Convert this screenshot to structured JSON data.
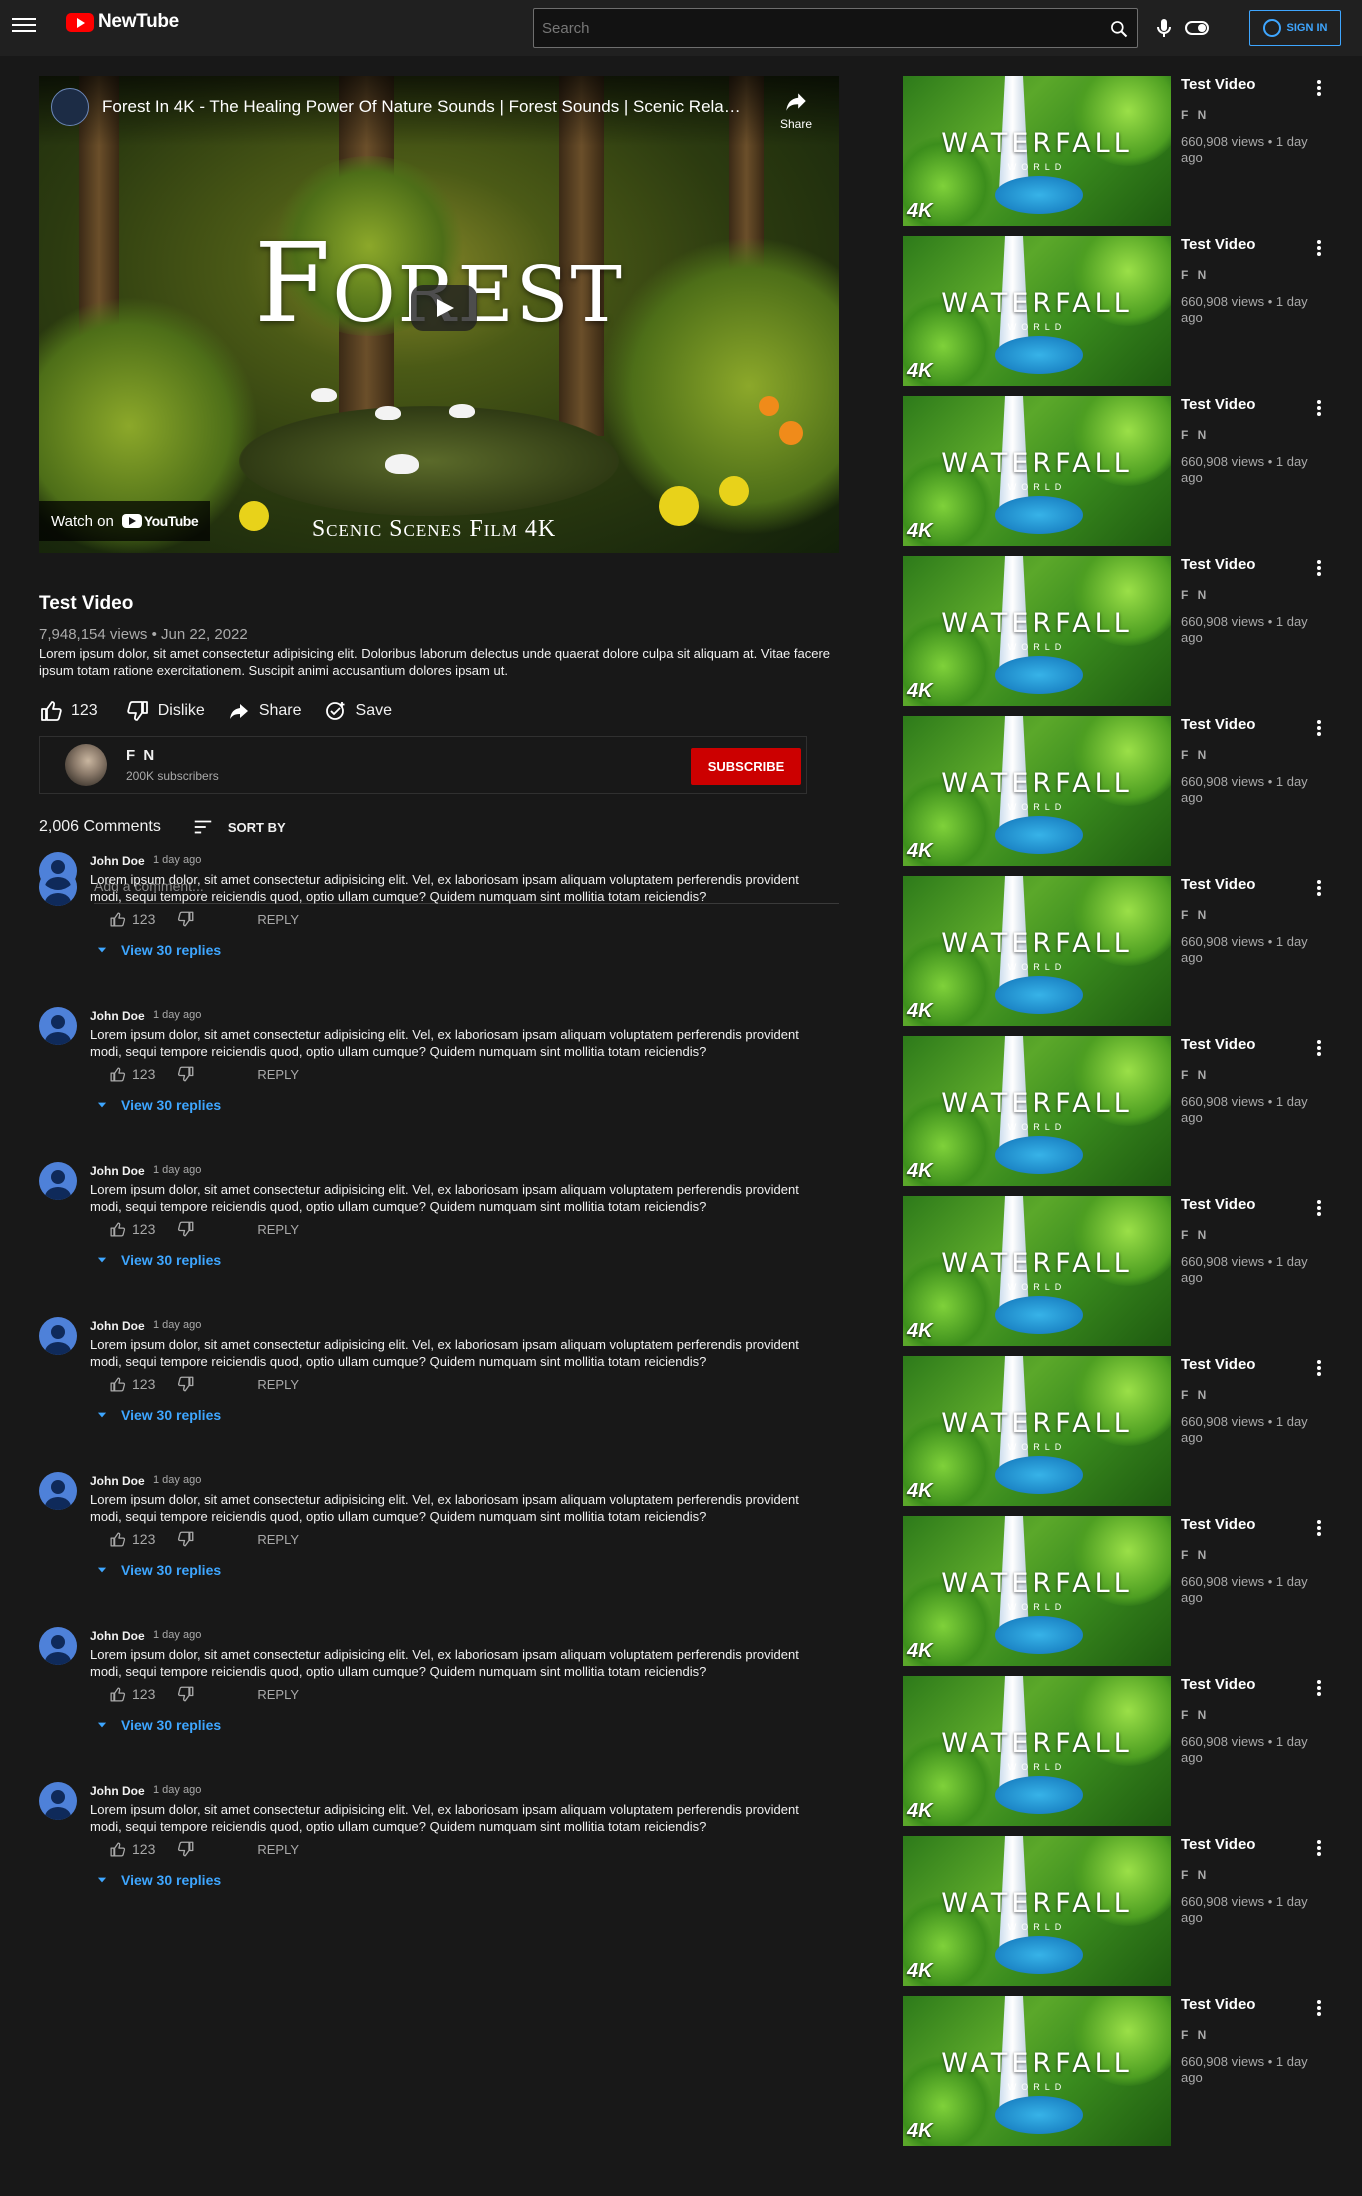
{
  "header": {
    "logo_text": "NewTube",
    "search_placeholder": "Search",
    "sign_in": "SIGN IN"
  },
  "player": {
    "overlay_title": "Forest In 4K - The Healing Power Of Nature Sounds | Forest Sounds | Scenic Rela…",
    "share": "Share",
    "big_word": "Forest",
    "scenic_text": "Scenic Scenes Film 4K",
    "watch_on": "Watch on",
    "youtube": "YouTube"
  },
  "video": {
    "title": "Test Video",
    "meta": "7,948,154 views • Jun 22, 2022",
    "description": "Lorem ipsum dolor, sit amet consectetur adipisicing elit. Doloribus laborum delectus unde quaerat dolore culpa sit aliquam at. Vitae facere ipsum totam ratione exercitationem. Suscipit animi accusantium dolores ipsam ut.",
    "likes": "123",
    "dislike": "Dislike",
    "share": "Share",
    "save": "Save"
  },
  "channel": {
    "name": "F N",
    "subscribers": "200K subscribers",
    "subscribe": "SUBSCRIBE"
  },
  "comments": {
    "count": "2,006 Comments",
    "sort_by": "SORT BY",
    "add_placeholder": "Add a comment...",
    "items": [
      {
        "author": "John Doe",
        "time": "1 day ago",
        "text": "Lorem ipsum dolor, sit amet consectetur adipisicing elit. Vel, ex laboriosam ipsam aliquam voluptatem perferendis provident modi, sequi tempore reiciendis quod, optio ullam cumque? Quidem numquam sint mollitia totam reiciendis?",
        "likes": "123",
        "reply": "REPLY",
        "replies": "View 30 replies"
      },
      {
        "author": "John Doe",
        "time": "1 day ago",
        "text": "Lorem ipsum dolor, sit amet consectetur adipisicing elit. Vel, ex laboriosam ipsam aliquam voluptatem perferendis provident modi, sequi tempore reiciendis quod, optio ullam cumque? Quidem numquam sint mollitia totam reiciendis?",
        "likes": "123",
        "reply": "REPLY",
        "replies": "View 30 replies"
      },
      {
        "author": "John Doe",
        "time": "1 day ago",
        "text": "Lorem ipsum dolor, sit amet consectetur adipisicing elit. Vel, ex laboriosam ipsam aliquam voluptatem perferendis provident modi, sequi tempore reiciendis quod, optio ullam cumque? Quidem numquam sint mollitia totam reiciendis?",
        "likes": "123",
        "reply": "REPLY",
        "replies": "View 30 replies"
      },
      {
        "author": "John Doe",
        "time": "1 day ago",
        "text": "Lorem ipsum dolor, sit amet consectetur adipisicing elit. Vel, ex laboriosam ipsam aliquam voluptatem perferendis provident modi, sequi tempore reiciendis quod, optio ullam cumque? Quidem numquam sint mollitia totam reiciendis?",
        "likes": "123",
        "reply": "REPLY",
        "replies": "View 30 replies"
      },
      {
        "author": "John Doe",
        "time": "1 day ago",
        "text": "Lorem ipsum dolor, sit amet consectetur adipisicing elit. Vel, ex laboriosam ipsam aliquam voluptatem perferendis provident modi, sequi tempore reiciendis quod, optio ullam cumque? Quidem numquam sint mollitia totam reiciendis?",
        "likes": "123",
        "reply": "REPLY",
        "replies": "View 30 replies"
      },
      {
        "author": "John Doe",
        "time": "1 day ago",
        "text": "Lorem ipsum dolor, sit amet consectetur adipisicing elit. Vel, ex laboriosam ipsam aliquam voluptatem perferendis provident modi, sequi tempore reiciendis quod, optio ullam cumque? Quidem numquam sint mollitia totam reiciendis?",
        "likes": "123",
        "reply": "REPLY",
        "replies": "View 30 replies"
      },
      {
        "author": "John Doe",
        "time": "1 day ago",
        "text": "Lorem ipsum dolor, sit amet consectetur adipisicing elit. Vel, ex laboriosam ipsam aliquam voluptatem perferendis provident modi, sequi tempore reiciendis quod, optio ullam cumque? Quidem numquam sint mollitia totam reiciendis?",
        "likes": "123",
        "reply": "REPLY",
        "replies": "View 30 replies"
      }
    ]
  },
  "sidebar": {
    "items": [
      {
        "title": "Test Video",
        "channel": "F N",
        "meta": "660,908 views • 1 day ago",
        "thumb_text": "WATERFALL",
        "thumb_sub": "WORLD",
        "thumb_badge": "4K"
      },
      {
        "title": "Test Video",
        "channel": "F N",
        "meta": "660,908 views • 1 day ago",
        "thumb_text": "WATERFALL",
        "thumb_sub": "WORLD",
        "thumb_badge": "4K"
      },
      {
        "title": "Test Video",
        "channel": "F N",
        "meta": "660,908 views • 1 day ago",
        "thumb_text": "WATERFALL",
        "thumb_sub": "WORLD",
        "thumb_badge": "4K"
      },
      {
        "title": "Test Video",
        "channel": "F N",
        "meta": "660,908 views • 1 day ago",
        "thumb_text": "WATERFALL",
        "thumb_sub": "WORLD",
        "thumb_badge": "4K"
      },
      {
        "title": "Test Video",
        "channel": "F N",
        "meta": "660,908 views • 1 day ago",
        "thumb_text": "WATERFALL",
        "thumb_sub": "WORLD",
        "thumb_badge": "4K"
      },
      {
        "title": "Test Video",
        "channel": "F N",
        "meta": "660,908 views • 1 day ago",
        "thumb_text": "WATERFALL",
        "thumb_sub": "WORLD",
        "thumb_badge": "4K"
      },
      {
        "title": "Test Video",
        "channel": "F N",
        "meta": "660,908 views • 1 day ago",
        "thumb_text": "WATERFALL",
        "thumb_sub": "WORLD",
        "thumb_badge": "4K"
      },
      {
        "title": "Test Video",
        "channel": "F N",
        "meta": "660,908 views • 1 day ago",
        "thumb_text": "WATERFALL",
        "thumb_sub": "WORLD",
        "thumb_badge": "4K"
      },
      {
        "title": "Test Video",
        "channel": "F N",
        "meta": "660,908 views • 1 day ago",
        "thumb_text": "WATERFALL",
        "thumb_sub": "WORLD",
        "thumb_badge": "4K"
      },
      {
        "title": "Test Video",
        "channel": "F N",
        "meta": "660,908 views • 1 day ago",
        "thumb_text": "WATERFALL",
        "thumb_sub": "WORLD",
        "thumb_badge": "4K"
      },
      {
        "title": "Test Video",
        "channel": "F N",
        "meta": "660,908 views • 1 day ago",
        "thumb_text": "WATERFALL",
        "thumb_sub": "WORLD",
        "thumb_badge": "4K"
      },
      {
        "title": "Test Video",
        "channel": "F N",
        "meta": "660,908 views • 1 day ago",
        "thumb_text": "WATERFALL",
        "thumb_sub": "WORLD",
        "thumb_badge": "4K"
      },
      {
        "title": "Test Video",
        "channel": "F N",
        "meta": "660,908 views • 1 day ago",
        "thumb_text": "WATERFALL",
        "thumb_sub": "WORLD",
        "thumb_badge": "4K"
      }
    ]
  },
  "colors": {
    "background": "#181818",
    "header": "#202020",
    "accent": "#3ea6ff",
    "subscribe": "#cc0000",
    "logo": "#ff0000"
  }
}
